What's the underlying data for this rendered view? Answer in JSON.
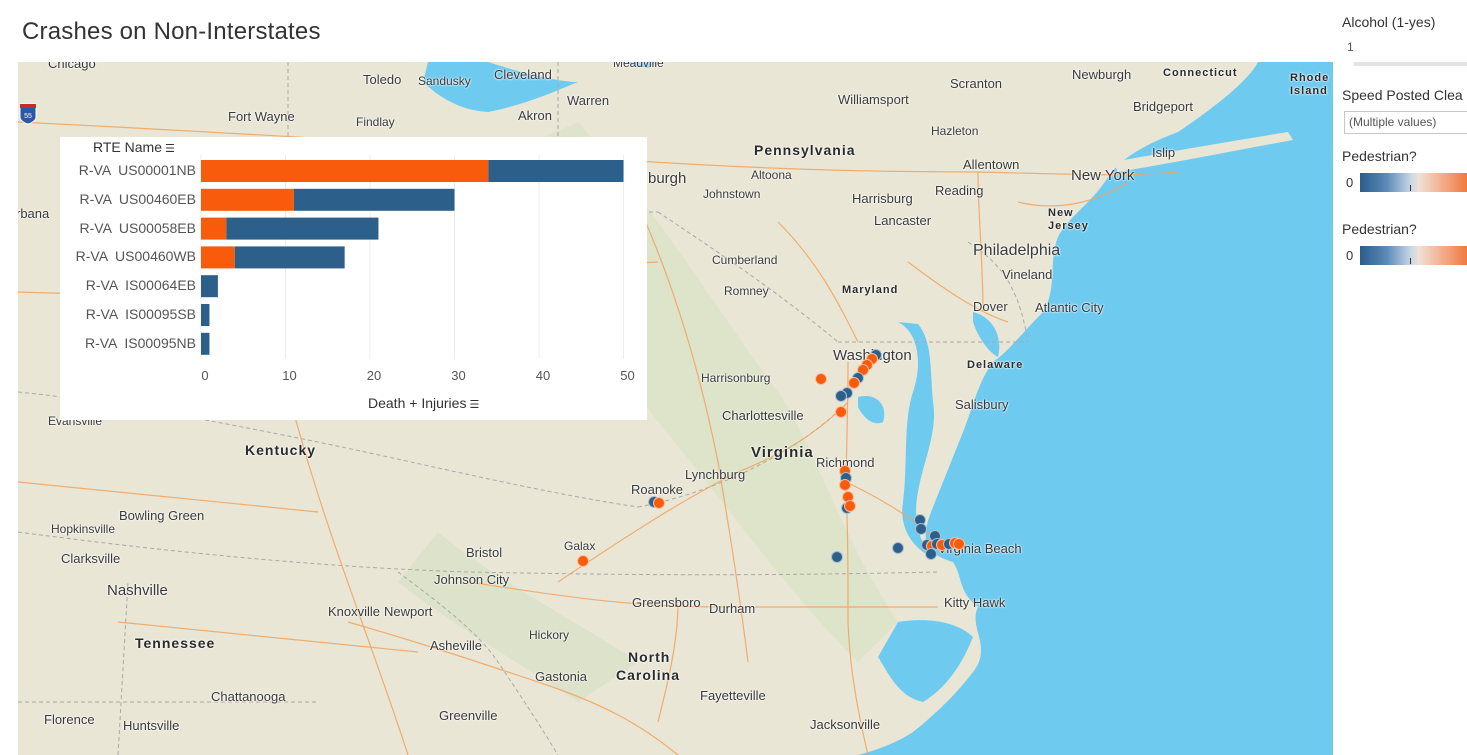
{
  "title": "Crashes on Non-Interstates",
  "colors": {
    "death_series": "#f85b0b",
    "injury_series": "#2d5f8b",
    "water": "#6fcaf0",
    "land": "#e9e6d6"
  },
  "map": {
    "shield_label": "55",
    "cities": [
      "Chicago",
      "Toledo",
      "Sandusky",
      "Cleveland",
      "Meadville",
      "Scranton",
      "Newburgh",
      "Connecticut",
      "Rhode Island",
      "Warren",
      "Williamsport",
      "Bridgeport",
      "Fort Wayne",
      "Findlay",
      "Akron",
      "Hazleton",
      "Islip",
      "Pennsylvania",
      "Allentown",
      "New York",
      "burgh",
      "Altoona",
      "Johnstown",
      "Harrisburg",
      "Reading",
      "New Jersey",
      "Lancaster",
      "Philadelphia",
      "Vineland",
      "Cumberland",
      "Romney",
      "Dover",
      "Atlantic City",
      "Washington",
      "Harrisonburg",
      "Delaware",
      "Salisbury",
      "Charlottesville",
      "Evansville",
      "Virginia",
      "Richmond",
      "Kentucky",
      "Lynchburg",
      "Roanoke",
      "Bowling Green",
      "Hopkinsville",
      "Virginia Beach",
      "Clarksville",
      "Bristol",
      "Galax",
      "Nashville",
      "Johnson City",
      "Knoxville",
      "Newport",
      "Greensboro",
      "Durham",
      "Kitty Hawk",
      "Hickory",
      "Tennessee",
      "Asheville",
      "North",
      "Carolina",
      "Gastonia",
      "Chattanooga",
      "Fayetteville",
      "Florence",
      "Huntsville",
      "Greenville",
      "Jacksonville",
      "rbana",
      "Maryland"
    ]
  },
  "chart_data": {
    "type": "bar",
    "stacked": true,
    "orientation": "horizontal",
    "row_header": "RTE Name",
    "xlabel": "Death + Injuries",
    "xlim": [
      0,
      52
    ],
    "xticks": [
      "0",
      "10",
      "20",
      "30",
      "40",
      "50"
    ],
    "categories": [
      "R-VA  US00001NB",
      "R-VA  US00460EB",
      "R-VA  US00058EB",
      "R-VA  US00460WB",
      "R-VA  IS00064EB",
      "R-VA  IS00095SB",
      "R-VA  IS00095NB"
    ],
    "series": [
      {
        "values": [
          34,
          11,
          3,
          4,
          0,
          0,
          0
        ]
      },
      {
        "values": [
          16,
          19,
          18,
          13,
          2,
          1,
          1
        ]
      }
    ],
    "grid": true
  },
  "filters": {
    "alcohol": {
      "label": "Alcohol (1-yes)",
      "value": "1"
    },
    "speed": {
      "label": "Speed Posted Clea",
      "value": "(Multiple values)"
    },
    "ped1": {
      "label": "Pedestrian?",
      "min": "0"
    },
    "ped2": {
      "label": "Pedestrian?",
      "min": "0"
    }
  }
}
